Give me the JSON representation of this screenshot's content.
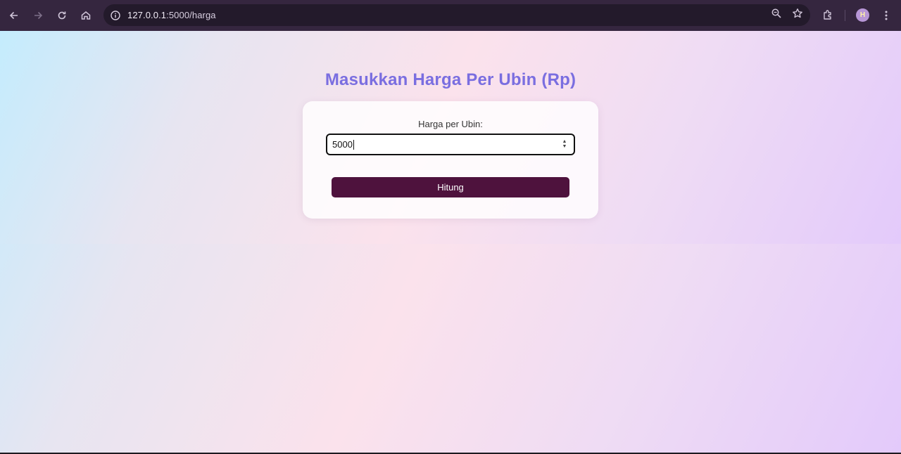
{
  "browser": {
    "url_host": "127.0.0.1",
    "url_rest": ":5000/harga",
    "avatar_letter": "H"
  },
  "page": {
    "title": "Masukkan Harga Per Ubin (Rp)",
    "form": {
      "label": "Harga per Ubin:",
      "value": "5000",
      "submit_label": "Hitung"
    }
  },
  "colors": {
    "title": "#7a6ee0",
    "button": "#4e123d",
    "chrome": "#35263f"
  }
}
